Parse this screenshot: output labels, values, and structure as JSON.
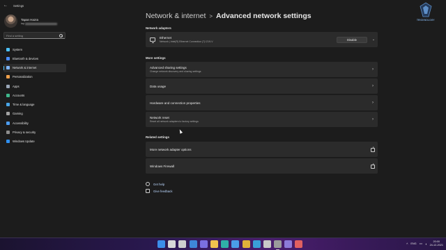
{
  "window": {
    "app_title": "Settings"
  },
  "profile": {
    "name": "Tapan Hazra",
    "email_visible_prefix": "tap"
  },
  "search": {
    "placeholder": "Find a setting"
  },
  "sidebar": {
    "items": [
      {
        "label": "System",
        "icon": "monitor-icon",
        "color": "#4cc2ff"
      },
      {
        "label": "Bluetooth & devices",
        "icon": "bluetooth-icon",
        "color": "#4a8cff"
      },
      {
        "label": "Network & internet",
        "icon": "wifi-icon",
        "color": "#7fb6ff",
        "active": true
      },
      {
        "label": "Personalization",
        "icon": "brush-icon",
        "color": "#f0a04b"
      },
      {
        "label": "Apps",
        "icon": "apps-icon",
        "color": "#9aa7b8"
      },
      {
        "label": "Accounts",
        "icon": "person-icon",
        "color": "#3fb68b"
      },
      {
        "label": "Time & language",
        "icon": "globe-clock-icon",
        "color": "#49a6e8"
      },
      {
        "label": "Gaming",
        "icon": "gamepad-icon",
        "color": "#a3a3a3"
      },
      {
        "label": "Accessibility",
        "icon": "accessibility-icon",
        "color": "#4c9cf0"
      },
      {
        "label": "Privacy & security",
        "icon": "shield-icon",
        "color": "#8d8d8d"
      },
      {
        "label": "Windows Update",
        "icon": "update-icon",
        "color": "#2f8ff0"
      }
    ]
  },
  "header": {
    "parent": "Network & internet",
    "separator": ">",
    "current": "Advanced network settings"
  },
  "sections": {
    "adapters_label": "Network adapters",
    "more_label": "More settings",
    "related_label": "Related settings"
  },
  "adapter": {
    "name": "Ethernet",
    "description": "Network | Intel(R) Ethernet Connection (7) I219-V",
    "disable_label": "Disable",
    "expand_icon": "chevron-down-icon"
  },
  "more_settings": [
    {
      "title": "Advanced sharing settings",
      "desc": "Change network discovery and sharing settings"
    },
    {
      "title": "Data usage",
      "desc": ""
    },
    {
      "title": "Hardware and connection properties",
      "desc": ""
    },
    {
      "title": "Network reset",
      "desc": "Reset all network adapters to factory settings"
    }
  ],
  "related_settings": [
    {
      "title": "More network adapter options"
    },
    {
      "title": "Windows Firewall"
    }
  ],
  "help": {
    "get_help": "Get help",
    "give_feedback": "Give feedback"
  },
  "watermark": {
    "text": "TRICKNOLOGY"
  },
  "taskbar": {
    "icons": [
      {
        "name": "start-icon",
        "color": "#3b8eea"
      },
      {
        "name": "search-icon",
        "color": "#d8d8d8"
      },
      {
        "name": "task-view-icon",
        "color": "#cfcfcf"
      },
      {
        "name": "widgets-icon",
        "color": "#3e86d8"
      },
      {
        "name": "chat-icon",
        "color": "#7b6fe0"
      },
      {
        "name": "file-explorer-icon",
        "color": "#f2c14e"
      },
      {
        "name": "edge-icon",
        "color": "#2fb0a8"
      },
      {
        "name": "store-icon",
        "color": "#4a9de8"
      },
      {
        "name": "chrome-icon",
        "color": "#e0b23a"
      },
      {
        "name": "app-icon",
        "color": "#3aa0d8"
      },
      {
        "name": "app-icon-2",
        "color": "#c8c8c8"
      },
      {
        "name": "settings-icon",
        "color": "#9b9b9b"
      },
      {
        "name": "app-icon-3",
        "color": "#8c7ad8"
      },
      {
        "name": "app-icon-4",
        "color": "#e06060"
      }
    ],
    "tray": {
      "chevron": "^",
      "lang": "ENG",
      "time": "20:00",
      "date": "24-12-2021"
    }
  }
}
